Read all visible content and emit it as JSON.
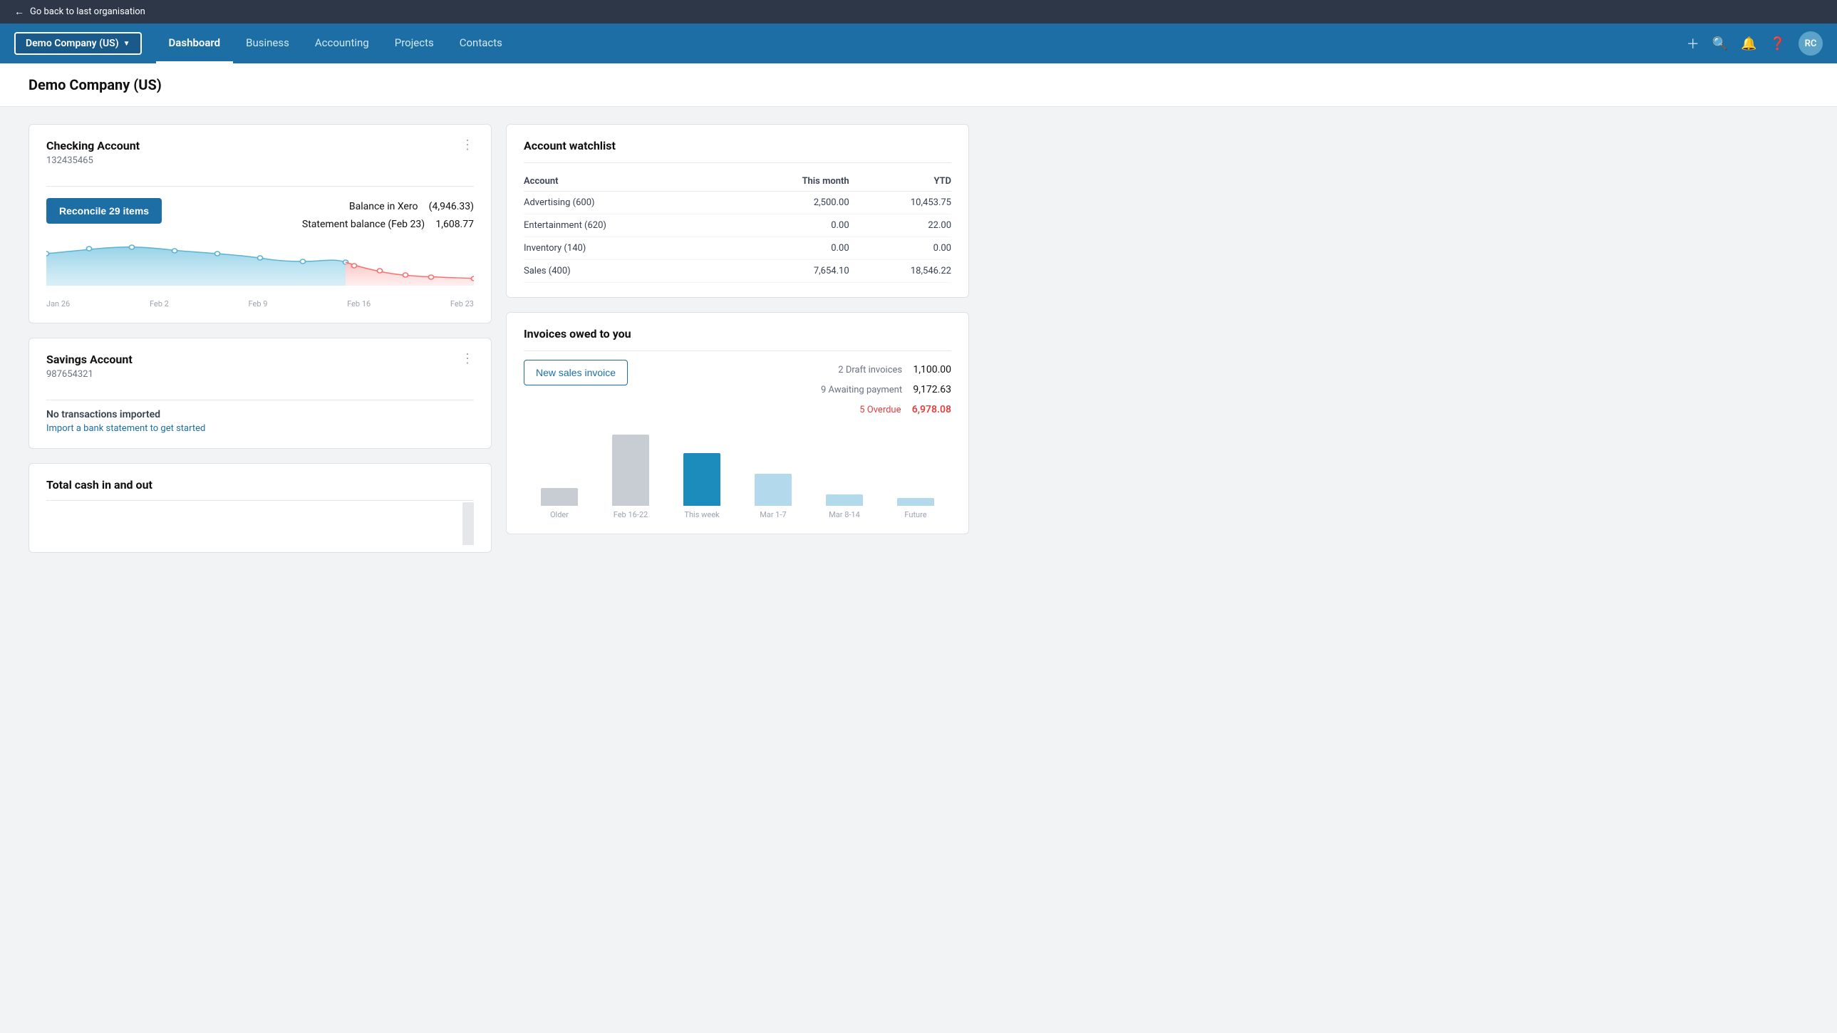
{
  "topbar": {
    "back_label": "Go back to last organisation"
  },
  "nav": {
    "company_name": "Demo Company (US)",
    "items": [
      {
        "label": "Dashboard",
        "active": true
      },
      {
        "label": "Business",
        "active": false
      },
      {
        "label": "Accounting",
        "active": false
      },
      {
        "label": "Projects",
        "active": false
      },
      {
        "label": "Contacts",
        "active": false
      }
    ],
    "avatar": "RC"
  },
  "page": {
    "title": "Demo Company (US)"
  },
  "checking": {
    "title": "Checking Account",
    "account_number": "132435465",
    "reconcile_label": "Reconcile 29 items",
    "balance_in_xero_label": "Balance in Xero",
    "balance_in_xero_value": "(4,946.33)",
    "statement_balance_label": "Statement balance (Feb 23)",
    "statement_balance_value": "1,608.77",
    "chart_labels": [
      "Jan 26",
      "Feb 2",
      "Feb 9",
      "Feb 16",
      "Feb 23"
    ]
  },
  "savings": {
    "title": "Savings Account",
    "account_number": "987654321",
    "no_transactions": "No transactions imported",
    "import_link": "Import a bank statement to get started"
  },
  "total_cash": {
    "title": "Total cash in and out"
  },
  "watchlist": {
    "title": "Account watchlist",
    "col_account": "Account",
    "col_this_month": "This month",
    "col_ytd": "YTD",
    "rows": [
      {
        "account": "Advertising (600)",
        "this_month": "2,500.00",
        "ytd": "10,453.75"
      },
      {
        "account": "Entertainment (620)",
        "this_month": "0.00",
        "ytd": "22.00"
      },
      {
        "account": "Inventory (140)",
        "this_month": "0.00",
        "ytd": "0.00"
      },
      {
        "account": "Sales (400)",
        "this_month": "7,654.10",
        "ytd": "18,546.22"
      }
    ]
  },
  "invoices": {
    "title": "Invoices owed to you",
    "new_invoice_label": "New sales invoice",
    "draft_label": "2 Draft invoices",
    "draft_amount": "1,100.00",
    "awaiting_label": "9 Awaiting payment",
    "awaiting_amount": "9,172.63",
    "overdue_label": "5 Overdue",
    "overdue_amount": "6,978.08",
    "chart_bars": [
      {
        "label": "Older",
        "height": 22,
        "color": "#c8cdd4"
      },
      {
        "label": "Feb 16-22",
        "height": 88,
        "color": "#c8cdd4"
      },
      {
        "label": "This week",
        "height": 65,
        "color": "#1c8cbc"
      },
      {
        "label": "Mar 1-7",
        "height": 40,
        "color": "#b3d9ec"
      },
      {
        "label": "Mar 8-14",
        "height": 14,
        "color": "#b3d9ec"
      },
      {
        "label": "Future",
        "height": 10,
        "color": "#b3d9ec"
      }
    ]
  }
}
